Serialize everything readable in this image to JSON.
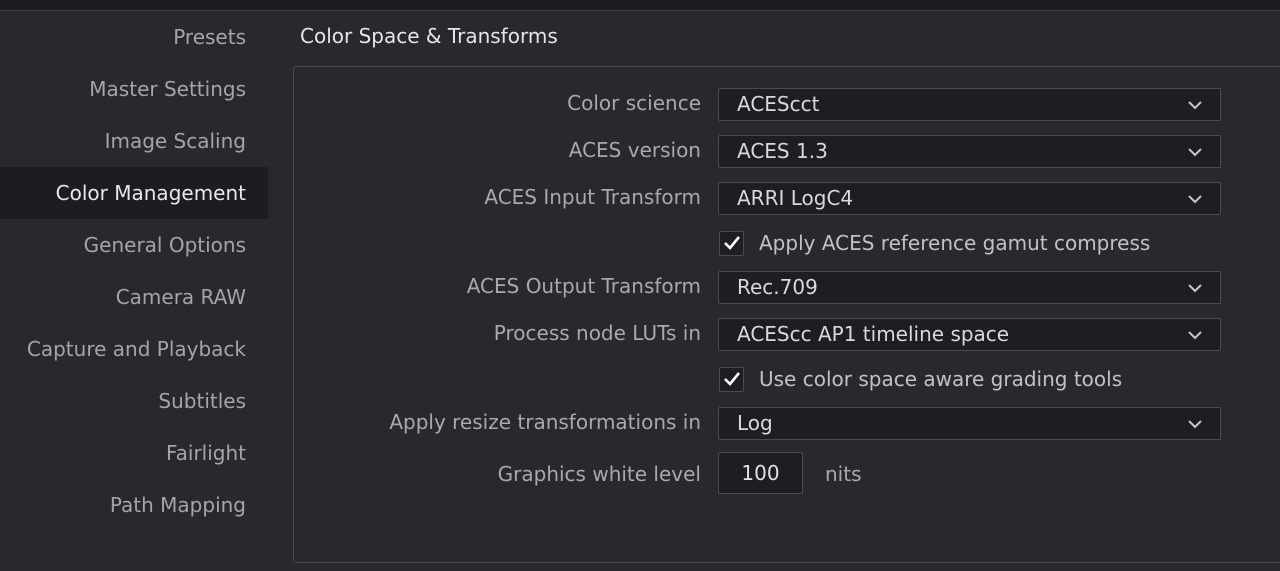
{
  "sidebar": {
    "items": [
      {
        "label": "Presets"
      },
      {
        "label": "Master Settings"
      },
      {
        "label": "Image Scaling"
      },
      {
        "label": "Color Management"
      },
      {
        "label": "General Options"
      },
      {
        "label": "Camera RAW"
      },
      {
        "label": "Capture and Playback"
      },
      {
        "label": "Subtitles"
      },
      {
        "label": "Fairlight"
      },
      {
        "label": "Path Mapping"
      }
    ],
    "active": "Color Management"
  },
  "section": {
    "title": "Color Space & Transforms"
  },
  "settings": {
    "color_science": {
      "label": "Color science",
      "value": "ACEScct"
    },
    "aces_version": {
      "label": "ACES version",
      "value": "ACES 1.3"
    },
    "aces_input": {
      "label": "ACES Input Transform",
      "value": "ARRI LogC4"
    },
    "gamut_compress": {
      "label": "Apply ACES reference gamut compress",
      "checked": true
    },
    "aces_output": {
      "label": "ACES Output Transform",
      "value": "Rec.709"
    },
    "process_luts": {
      "label": "Process node LUTs in",
      "value": "ACEScc AP1 timeline space"
    },
    "color_aware": {
      "label": "Use color space aware grading tools",
      "checked": true
    },
    "resize_transform": {
      "label": "Apply resize transformations in",
      "value": "Log"
    },
    "white_level": {
      "label": "Graphics white level",
      "value": "100",
      "unit": "nits"
    }
  },
  "icons": {
    "dropdown": "chevron-down-icon",
    "checkbox": "checkmark-icon"
  },
  "colors": {
    "background": "#28282e",
    "sidebar_active": "#1d1d21",
    "field": "#1e1e22",
    "border": "#4a4a50"
  }
}
